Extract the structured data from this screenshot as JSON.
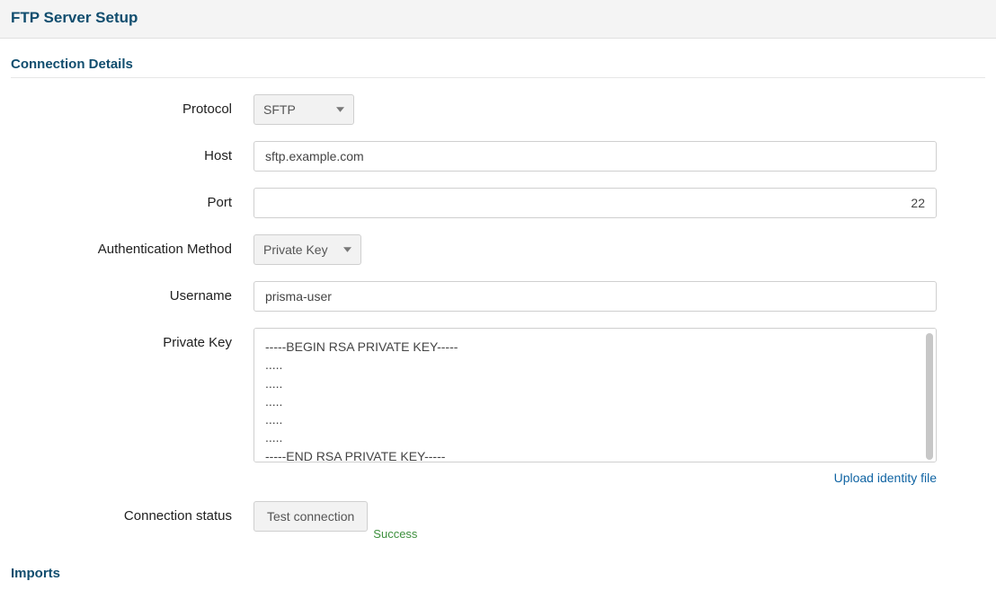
{
  "header": {
    "title": "FTP Server Setup"
  },
  "sections": {
    "connection": {
      "title": "Connection Details",
      "protocol_label": "Protocol",
      "protocol_value": "SFTP",
      "host_label": "Host",
      "host_value": "sftp.example.com",
      "port_label": "Port",
      "port_value": "22",
      "auth_label": "Authentication Method",
      "auth_value": "Private Key",
      "username_label": "Username",
      "username_value": "prisma-user",
      "private_key_label": "Private Key",
      "private_key_value": "-----BEGIN RSA PRIVATE KEY-----\n.....\n.....\n.....\n.....\n.....\n-----END RSA PRIVATE KEY-----",
      "upload_link": "Upload identity file",
      "connection_status_label": "Connection status",
      "test_connection_label": "Test connection",
      "connection_result": "Success"
    },
    "imports": {
      "title": "Imports"
    }
  }
}
